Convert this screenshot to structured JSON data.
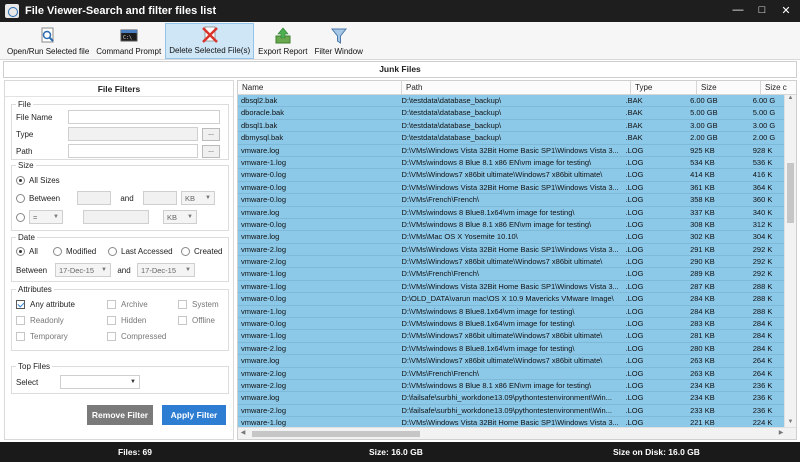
{
  "window": {
    "title": "File Viewer-Search and filter files list"
  },
  "toolbar": {
    "open_run": "Open/Run Selected file",
    "command_prompt": "Command Prompt",
    "delete_selected": "Delete Selected File(s)",
    "export_report": "Export Report",
    "filter_window": "Filter Window"
  },
  "section_title": "Junk Files",
  "filters": {
    "title": "File Filters",
    "file": {
      "legend": "File",
      "name_label": "File Name",
      "type_label": "Type",
      "path_label": "Path",
      "browse": "..."
    },
    "size": {
      "legend": "Size",
      "all_sizes": "All Sizes",
      "between": "Between",
      "and": "and",
      "unit1": "KB",
      "unit2": "KB",
      "operator": "="
    },
    "date": {
      "legend": "Date",
      "all": "All",
      "modified": "Modified",
      "last_accessed": "Last Accessed",
      "created": "Created",
      "between": "Between",
      "and": "and",
      "from": "17-Dec-15",
      "to": "17-Dec-15"
    },
    "attributes": {
      "legend": "Attributes",
      "any": "Any attribute",
      "archive": "Archive",
      "system": "System",
      "readonly": "Readonly",
      "hidden": "Hidden",
      "offline": "Offline",
      "temporary": "Temporary",
      "compressed": "Compressed"
    },
    "top_files": {
      "legend": "Top Files",
      "select_label": "Select"
    },
    "remove_filter": "Remove Filter",
    "apply_filter": "Apply Filter"
  },
  "table": {
    "columns": [
      "Name",
      "Path",
      "Type",
      "Size",
      "Size c"
    ],
    "rows": [
      [
        "dbsql2.bak",
        "D:\\testdata\\database_backup\\",
        ".BAK",
        "6.00 GB",
        "6.00 G"
      ],
      [
        "dboracle.bak",
        "D:\\testdata\\database_backup\\",
        ".BAK",
        "5.00 GB",
        "5.00 G"
      ],
      [
        "dbsql1.bak",
        "D:\\testdata\\database_backup\\",
        ".BAK",
        "3.00 GB",
        "3.00 G"
      ],
      [
        "dbmysql.bak",
        "D:\\testdata\\database_backup\\",
        ".BAK",
        "2.00 GB",
        "2.00 G"
      ],
      [
        "vmware.log",
        "D:\\VMs\\Windows Vista 32Bit Home Basic SP1\\Windows Vista 3...",
        ".LOG",
        "925 KB",
        "928 K"
      ],
      [
        "vmware-1.log",
        "D:\\VMs\\windows 8 Blue 8.1 x86 EN\\vm image for testing\\",
        ".LOG",
        "534 KB",
        "536 K"
      ],
      [
        "vmware-0.log",
        "D:\\VMs\\Windows7 x86bit ultimate\\Windows7 x86bit ultimate\\",
        ".LOG",
        "414 KB",
        "416 K"
      ],
      [
        "vmware-0.log",
        "D:\\VMs\\Windows Vista 32Bit Home Basic SP1\\Windows Vista 3...",
        ".LOG",
        "361 KB",
        "364 K"
      ],
      [
        "vmware-0.log",
        "D:\\VMs\\French\\French\\",
        ".LOG",
        "358 KB",
        "360 K"
      ],
      [
        "vmware.log",
        "D:\\VMs\\windows 8 Blue8.1x64\\vm image for testing\\",
        ".LOG",
        "337 KB",
        "340 K"
      ],
      [
        "vmware-0.log",
        "D:\\VMs\\windows 8 Blue 8.1 x86 EN\\vm image for testing\\",
        ".LOG",
        "308 KB",
        "312 K"
      ],
      [
        "vmware.log",
        "D:\\VMs\\Mac OS X Yosemite 10.10\\",
        ".LOG",
        "302 KB",
        "304 K"
      ],
      [
        "vmware-2.log",
        "D:\\VMs\\Windows Vista 32Bit Home Basic SP1\\Windows Vista 3...",
        ".LOG",
        "291 KB",
        "292 K"
      ],
      [
        "vmware-2.log",
        "D:\\VMs\\Windows7 x86bit ultimate\\Windows7 x86bit ultimate\\",
        ".LOG",
        "290 KB",
        "292 K"
      ],
      [
        "vmware-1.log",
        "D:\\VMs\\French\\French\\",
        ".LOG",
        "289 KB",
        "292 K"
      ],
      [
        "vmware-1.log",
        "D:\\VMs\\Windows Vista 32Bit Home Basic SP1\\Windows Vista 3...",
        ".LOG",
        "287 KB",
        "288 K"
      ],
      [
        "vmware-0.log",
        "D:\\OLD_DATA\\varun mac\\OS X 10.9 Mavericks VMware Image\\",
        ".LOG",
        "284 KB",
        "288 K"
      ],
      [
        "vmware-1.log",
        "D:\\VMs\\windows 8 Blue8.1x64\\vm image for testing\\",
        ".LOG",
        "284 KB",
        "288 K"
      ],
      [
        "vmware-0.log",
        "D:\\VMs\\windows 8 Blue8.1x64\\vm image for testing\\",
        ".LOG",
        "283 KB",
        "284 K"
      ],
      [
        "vmware-1.log",
        "D:\\VMs\\Windows7 x86bit ultimate\\Windows7 x86bit ultimate\\",
        ".LOG",
        "281 KB",
        "284 K"
      ],
      [
        "vmware-2.log",
        "D:\\VMs\\windows 8 Blue8.1x64\\vm image for testing\\",
        ".LOG",
        "280 KB",
        "284 K"
      ],
      [
        "vmware.log",
        "D:\\VMs\\Windows7 x86bit ultimate\\Windows7 x86bit ultimate\\",
        ".LOG",
        "263 KB",
        "264 K"
      ],
      [
        "vmware-2.log",
        "D:\\VMs\\French\\French\\",
        ".LOG",
        "263 KB",
        "264 K"
      ],
      [
        "vmware-2.log",
        "D:\\VMs\\windows 8 Blue 8.1 x86 EN\\vm image for testing\\",
        ".LOG",
        "234 KB",
        "236 K"
      ],
      [
        "vmware.log",
        "D:\\failsafe\\surbhi_workdone13.09\\pythontestenvironment\\Win...",
        ".LOG",
        "234 KB",
        "236 K"
      ],
      [
        "vmware-2.log",
        "D:\\failsafe\\surbhi_workdone13.09\\pythontestenvironment\\Win...",
        ".LOG",
        "233 KB",
        "236 K"
      ],
      [
        "vmware-1.log",
        "D:\\VMs\\Windows Vista 32Bit Home Basic SP1\\Windows Vista 3...",
        ".LOG",
        "221 KB",
        "224 K"
      ]
    ]
  },
  "status": {
    "files": "Files: 69",
    "size": "Size: 16.0 GB",
    "size_on_disk": "Size on Disk: 16.0 GB"
  },
  "colors": {
    "titlebar": "#1e1e1e",
    "row_selected": "#8cc8e8",
    "apply_button": "#2d7dd2",
    "remove_button": "#7a7a7a",
    "delete_icon": "#d9342b"
  }
}
